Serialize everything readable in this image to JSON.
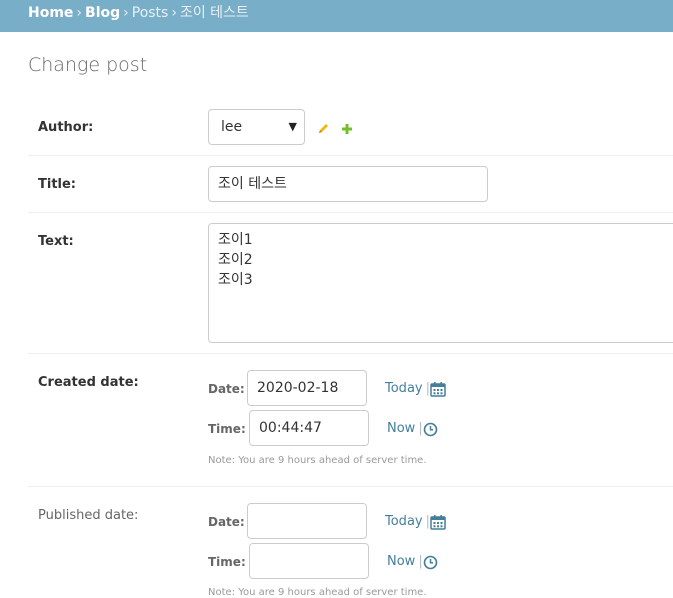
{
  "breadcrumbs": {
    "home": "Home",
    "app": "Blog",
    "model": "Posts",
    "current": "조이 테스트",
    "sep": "›"
  },
  "page_title": "Change post",
  "fields": {
    "author": {
      "label": "Author:",
      "value": "lee"
    },
    "title": {
      "label": "Title:",
      "value": "조이 테스트"
    },
    "text": {
      "label": "Text:",
      "value": "조이1\n조이2\n조이3"
    },
    "created_date": {
      "label": "Created date:",
      "date_label": "Date:",
      "date_value": "2020-02-18",
      "today_link": "Today",
      "time_label": "Time:",
      "time_value": "00:44:47",
      "now_link": "Now",
      "note": "Note: You are 9 hours ahead of server time."
    },
    "published_date": {
      "label": "Published date:",
      "date_label": "Date:",
      "date_value": "",
      "today_link": "Today",
      "time_label": "Time:",
      "time_value": "",
      "now_link": "Now",
      "note": "Note: You are 9 hours ahead of server time."
    }
  },
  "pipe": "|",
  "colors": {
    "header_bg": "#79aec8",
    "link": "#447e9b",
    "edit_icon": "#efb80b",
    "add_icon": "#70bf2b"
  }
}
